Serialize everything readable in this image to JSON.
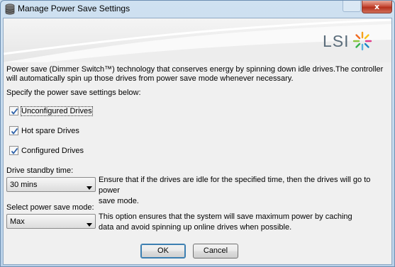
{
  "window": {
    "title": "Manage Power Save Settings",
    "close_glyph": "x"
  },
  "brand": {
    "logo_text": "LSI",
    "logo_icon": "lsi-starburst-icon"
  },
  "content": {
    "description_line1": "Power save (Dimmer Switch™) technology that conserves energy by spinning down idle drives.The controller",
    "description_line2": "will automatically spin up those drives from power save mode whenever necessary.",
    "specify_label": "Specify the power save settings below:",
    "checkboxes": [
      {
        "label": "Unconfigured Drives",
        "checked": true
      },
      {
        "label": "Hot spare Drives",
        "checked": true
      },
      {
        "label": "Configured Drives",
        "checked": true
      }
    ],
    "standby": {
      "label": "Drive standby time:",
      "value": "30 mins",
      "hint_line1": "Ensure that if the drives are idle for the specified time, then the drives will go to power",
      "hint_line2": "save mode."
    },
    "mode": {
      "label": "Select power save mode:",
      "value": "Max",
      "hint_line1": "This option ensures that the system will save maximum power by caching",
      "hint_line2": "data and avoid spinning up online drives when possible."
    }
  },
  "buttons": {
    "ok": "OK",
    "cancel": "Cancel"
  },
  "colors": {
    "close": "#c8503c",
    "accent": "#3c7fb1",
    "logo_text": "#5a6c7a"
  }
}
